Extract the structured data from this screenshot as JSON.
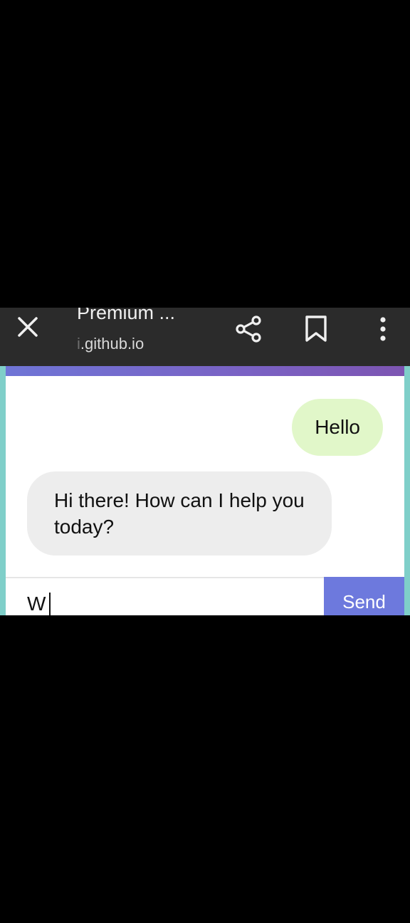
{
  "browser": {
    "title": "Premium ...",
    "url_hidden_prefix": "i",
    "url": ".github.io",
    "bar_color": "#2b2b2b",
    "icons": [
      "close-icon",
      "share-icon",
      "bookmark-icon",
      "more-vert-icon"
    ]
  },
  "chat": {
    "messages": [
      {
        "role": "user",
        "text": "Hello"
      },
      {
        "role": "bot",
        "text": "Hi there! How can I help you today?"
      }
    ],
    "input_value": "W",
    "send_label": "Send",
    "colors": {
      "user_bubble": "#e1f7c9",
      "bot_bubble": "#ededed",
      "send_button": "#6d79dd",
      "accent_strip": "#7a62c4",
      "side_border": "#7fcfc9"
    }
  }
}
